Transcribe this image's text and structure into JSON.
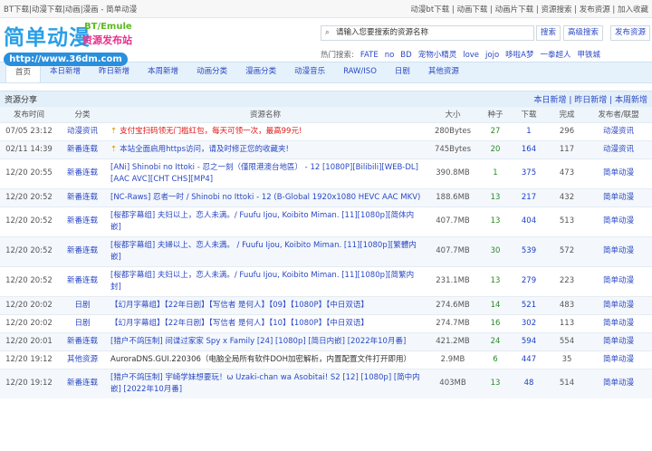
{
  "topbar": {
    "title": "BT下载|动漫下载|动画|漫画 - 简单动漫",
    "links": "动漫bt下载 | 动画下载 | 动画片下载 | 资源搜索 | 发布资源 | 加入收藏"
  },
  "logo": {
    "name": "简单动漫",
    "bt": "BT/Emule",
    "sub": "资源发布站",
    "url": "http://www.36dm.com"
  },
  "search": {
    "placeholder": "请输入您要搜索的资源名称",
    "search": "搜索",
    "advanced": "高级搜索",
    "publish": "发布资源",
    "hot_label": "热门搜索:",
    "hot": [
      "FATE",
      "no",
      "BD",
      "宠物小精灵",
      "love",
      "jojo",
      "哆啦A梦",
      "一拳超人",
      "甲铁城"
    ]
  },
  "nav": [
    "首页",
    "本日新增",
    "昨日新增",
    "本周新增",
    "动画分类",
    "漫画分类",
    "动漫音乐",
    "RAW/ISO",
    "日剧",
    "其他资源"
  ],
  "section": {
    "title": "资源分享",
    "links": "本日新增 | 昨日新增 | 本周新增"
  },
  "columns": [
    "发布时间",
    "分类",
    "资源名称",
    "大小",
    "种子",
    "下载",
    "完成",
    "发布者/联盟"
  ],
  "rows": [
    {
      "time": "07/05 23:12",
      "cat": "动漫资讯",
      "name": "支付宝扫码领无门槛红包，每天可领一次，最高99元!",
      "size": "280Bytes",
      "seed": "27",
      "dl": "1",
      "done": "296",
      "pub": "动漫资讯",
      "style": "red",
      "top": true
    },
    {
      "time": "02/11 14:39",
      "cat": "新番连载",
      "name": "本站全面启用https访问，请及时修正您的收藏夹!",
      "size": "745Bytes",
      "seed": "20",
      "dl": "164",
      "done": "117",
      "pub": "动漫资讯",
      "style": "",
      "top": true
    },
    {
      "time": "12/20 20:55",
      "cat": "新番连载",
      "name": "[ANi] Shinobi no Ittoki - 忍之一刻（僅限港澳台地區） - 12 [1080P][Bilibili][WEB-DL][AAC AVC][CHT CHS][MP4]",
      "size": "390.8MB",
      "seed": "1",
      "dl": "375",
      "done": "473",
      "pub": "简单动漫",
      "style": ""
    },
    {
      "time": "12/20 20:52",
      "cat": "新番连载",
      "name": "[NC-Raws] 忍者一时 / Shinobi no Ittoki - 12 (B-Global 1920x1080 HEVC AAC MKV)",
      "size": "188.6MB",
      "seed": "13",
      "dl": "217",
      "done": "432",
      "pub": "简单动漫",
      "style": ""
    },
    {
      "time": "12/20 20:52",
      "cat": "新番连载",
      "name": "[桜都字幕组] 夫妇以上，恋人未满。/ Fuufu Ijou, Koibito Miman. [11][1080p][简体内嵌]",
      "size": "407.7MB",
      "seed": "13",
      "dl": "404",
      "done": "513",
      "pub": "简单动漫",
      "style": ""
    },
    {
      "time": "12/20 20:52",
      "cat": "新番连载",
      "name": "[桜都字幕组] 夫婦以上、恋人未満。 / Fuufu Ijou, Koibito Miman. [11][1080p][繁體内嵌]",
      "size": "407.7MB",
      "seed": "30",
      "dl": "539",
      "done": "572",
      "pub": "简单动漫",
      "style": ""
    },
    {
      "time": "12/20 20:52",
      "cat": "新番连载",
      "name": "[桜都字幕组] 夫妇以上，恋人未满。/ Fuufu Ijou, Koibito Miman. [11][1080p][简繁内封]",
      "size": "231.1MB",
      "seed": "13",
      "dl": "279",
      "done": "223",
      "pub": "简单动漫",
      "style": ""
    },
    {
      "time": "12/20 20:02",
      "cat": "日剧",
      "name": "【幻月字幕组】【22年日剧】【写信者 是何人】【09】【1080P】【中日双语】",
      "size": "274.6MB",
      "seed": "14",
      "dl": "521",
      "done": "483",
      "pub": "简单动漫",
      "style": ""
    },
    {
      "time": "12/20 20:02",
      "cat": "日剧",
      "name": "【幻月字幕组】【22年日剧】【写信者 是何人】【10】【1080P】【中日双语】",
      "size": "274.7MB",
      "seed": "16",
      "dl": "302",
      "done": "113",
      "pub": "简单动漫",
      "style": ""
    },
    {
      "time": "12/20 20:01",
      "cat": "新番连载",
      "name": "[猎户不鸽压制] 间谍过家家 Spy x Family [24] [1080p] [简日内嵌] [2022年10月番]",
      "size": "421.2MB",
      "seed": "24",
      "dl": "594",
      "done": "554",
      "pub": "简单动漫",
      "style": ""
    },
    {
      "time": "12/20 19:12",
      "cat": "其他资源",
      "name": "AuroraDNS.GUI.220306（电脑全局所有软件DOH加密解析，内置配置文件打开即用）",
      "size": "2.9MB",
      "seed": "6",
      "dl": "447",
      "done": "35",
      "pub": "简单动漫",
      "style": "dark"
    },
    {
      "time": "12/20 19:12",
      "cat": "新番连载",
      "name": "[猎户不鸽压制] 宇崎学妹想要玩！ω Uzaki-chan wa Asobitai! S2 [12] [1080p] [简中内嵌] [2022年10月番]",
      "size": "403MB",
      "seed": "13",
      "dl": "48",
      "done": "514",
      "pub": "简单动漫",
      "style": ""
    }
  ]
}
